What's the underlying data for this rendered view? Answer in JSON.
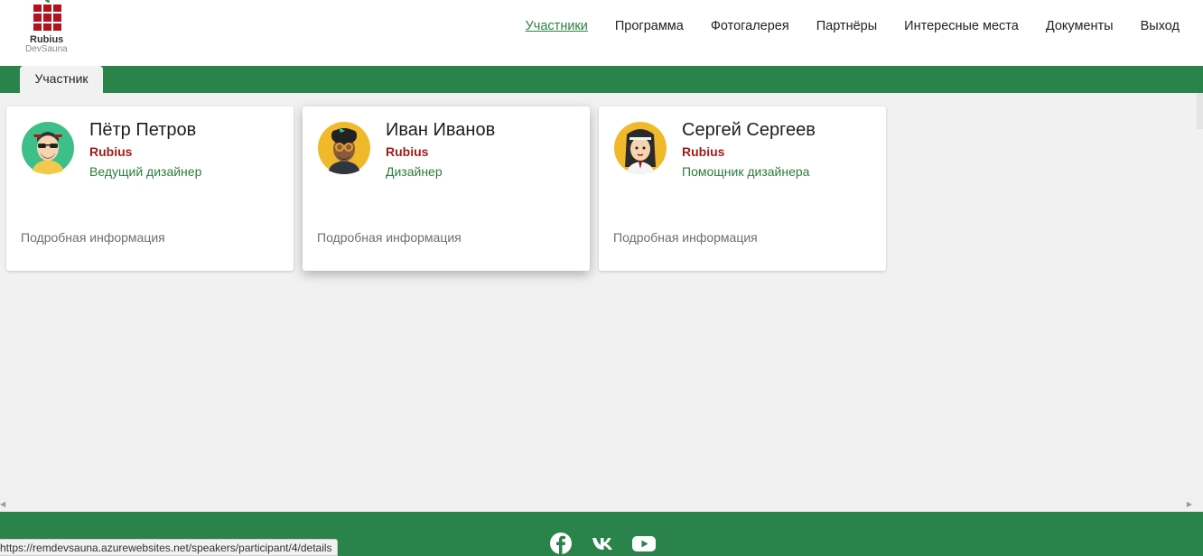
{
  "logo": {
    "name": "Rubius",
    "sub": "DevSauna"
  },
  "nav": [
    {
      "label": "Участники",
      "active": true
    },
    {
      "label": "Программа"
    },
    {
      "label": "Фотогалерея"
    },
    {
      "label": "Партнёры"
    },
    {
      "label": "Интересные места"
    },
    {
      "label": "Документы"
    },
    {
      "label": "Выход"
    }
  ],
  "tab": {
    "label": "Участник"
  },
  "cards": [
    {
      "name": "Пётр Петров",
      "company": "Rubius",
      "role": "Ведущий дизайнер",
      "more": "Подробная информация",
      "avatar": "avatar-bearded-sunglasses"
    },
    {
      "name": "Иван Иванов",
      "company": "Rubius",
      "role": "Дизайнер",
      "more": "Подробная информация",
      "avatar": "avatar-curly-hair-glasses"
    },
    {
      "name": "Сергей Сергеев",
      "company": "Rubius",
      "role": "Помощник дизайнера",
      "more": "Подробная информация",
      "avatar": "avatar-long-hair-headband"
    }
  ],
  "footer": {
    "icons": [
      "facebook-icon",
      "vk-icon",
      "youtube-icon"
    ]
  },
  "status": {
    "url": "https://remdevsauna.azurewebsites.net/speakers/participant/4/details"
  },
  "colors": {
    "accent_green": "#29834a",
    "brand_red": "#b3121c",
    "company_red": "#a01c1c",
    "role_green": "#2d7c3d"
  }
}
